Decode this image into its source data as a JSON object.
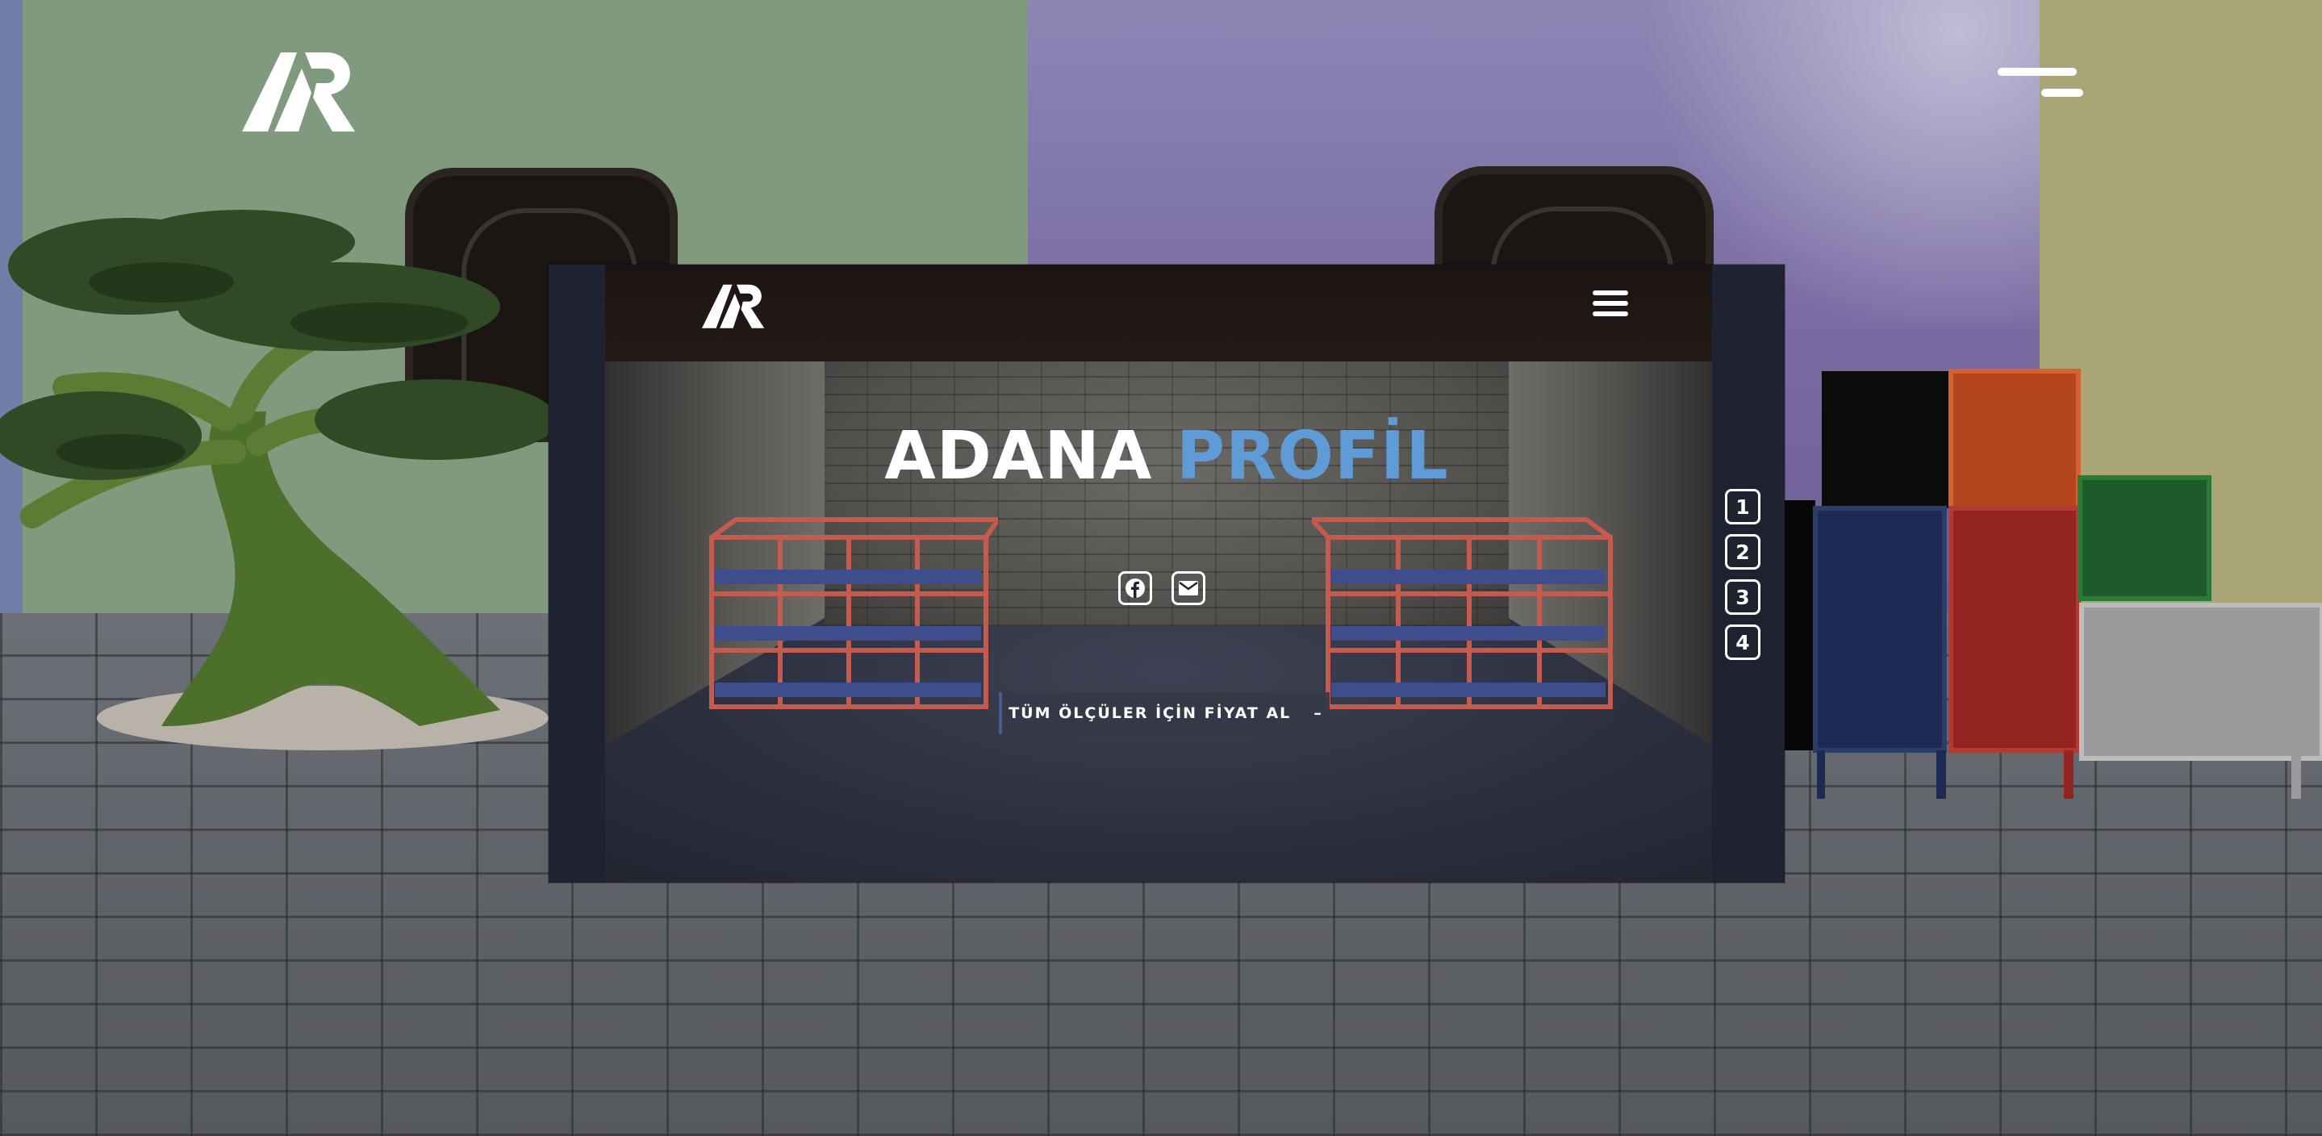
{
  "header": {
    "logo_icon": "ap-logo-icon",
    "menu_icon": "hamburger-menu-icon"
  },
  "preview": {
    "logo_icon": "ap-logo-icon",
    "menu_icon": "hamburger-menu-icon",
    "title_part1": "ADANA",
    "title_part2": "PROFİL",
    "social": [
      {
        "icon": "facebook-icon"
      },
      {
        "icon": "envelope-icon"
      }
    ],
    "cta_label": "TÜM ÖLÇÜLER İÇİN FİYAT AL",
    "cta_icon": "–",
    "pager": [
      "1",
      "2",
      "3",
      "4"
    ]
  },
  "colors": {
    "accent": "#5f9bd6",
    "wall_green": "#7f9a7c",
    "wall_purple": "#7768a0",
    "wall_olive": "#a9a577"
  }
}
